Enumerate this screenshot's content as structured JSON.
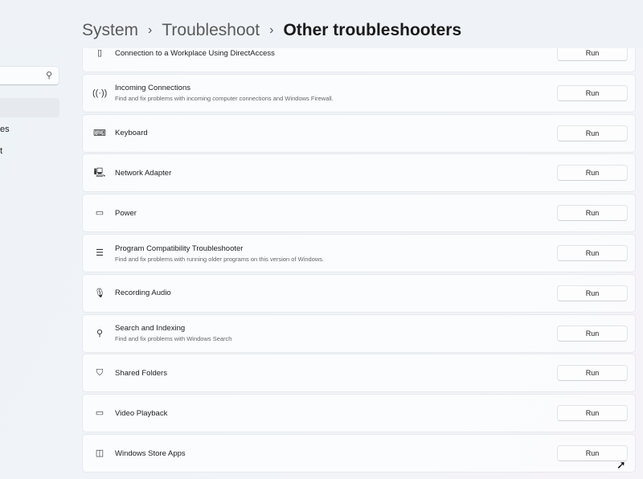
{
  "breadcrumb": [
    "System",
    "Troubleshoot",
    "Other troubleshooters"
  ],
  "sidebar": {
    "fragments": [
      "es",
      "t"
    ]
  },
  "run_label": "Run",
  "items": [
    {
      "title": "Connection to a Workplace Using DirectAccess",
      "desc": "",
      "icon": "phone-icon",
      "glyph": "▯"
    },
    {
      "title": "Incoming Connections",
      "desc": "Find and fix problems with incoming computer connections and Windows Firewall.",
      "icon": "antenna-icon",
      "glyph": "((·))"
    },
    {
      "title": "Keyboard",
      "desc": "",
      "icon": "keyboard-icon",
      "glyph": "⌨"
    },
    {
      "title": "Network Adapter",
      "desc": "",
      "icon": "network-adapter-icon",
      "glyph": "🖳"
    },
    {
      "title": "Power",
      "desc": "",
      "icon": "battery-icon",
      "glyph": "▭"
    },
    {
      "title": "Program Compatibility Troubleshooter",
      "desc": "Find and fix problems with running older programs on this version of Windows.",
      "icon": "list-icon",
      "glyph": "☰"
    },
    {
      "title": "Recording Audio",
      "desc": "",
      "icon": "microphone-icon",
      "glyph": "🎙"
    },
    {
      "title": "Search and Indexing",
      "desc": "Find and fix problems with Windows Search",
      "icon": "search-icon",
      "glyph": "⚲"
    },
    {
      "title": "Shared Folders",
      "desc": "",
      "icon": "shared-folder-icon",
      "glyph": "⛉"
    },
    {
      "title": "Video Playback",
      "desc": "",
      "icon": "video-camera-icon",
      "glyph": "▭"
    },
    {
      "title": "Windows Store Apps",
      "desc": "",
      "icon": "store-apps-icon",
      "glyph": "◫"
    }
  ]
}
